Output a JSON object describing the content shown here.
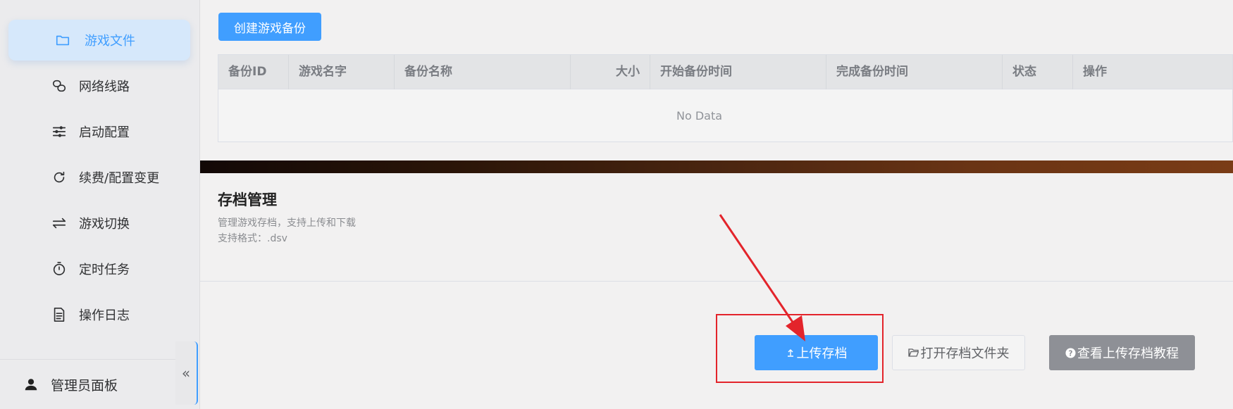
{
  "sidebar": {
    "items": [
      {
        "label": "游戏文件",
        "icon": "folder-icon",
        "active": true
      },
      {
        "label": "网络线路",
        "icon": "link-icon"
      },
      {
        "label": "启动配置",
        "icon": "sliders-icon"
      },
      {
        "label": "续费/配置变更",
        "icon": "refresh-icon"
      },
      {
        "label": "游戏切换",
        "icon": "switch-icon"
      },
      {
        "label": "定时任务",
        "icon": "stopwatch-icon"
      },
      {
        "label": "操作日志",
        "icon": "document-icon"
      }
    ],
    "admin_label": "管理员面板",
    "collapse_glyph": "«"
  },
  "backup": {
    "create_button": "创建游戏备份",
    "columns": [
      "备份ID",
      "游戏名字",
      "备份名称",
      "大小",
      "开始备份时间",
      "完成备份时间",
      "状态",
      "操作"
    ],
    "empty_text": "No Data"
  },
  "saves": {
    "title": "存档管理",
    "desc_line1": "管理游戏存档，支持上传和下载",
    "desc_line2": "支持格式：.dsv",
    "upload_button": "上传存档",
    "open_folder_button": "打开存档文件夹",
    "tutorial_button": "查看上传存档教程"
  },
  "colors": {
    "primary": "#409eff",
    "info": "#8e9096",
    "highlight": "#e3242b"
  }
}
